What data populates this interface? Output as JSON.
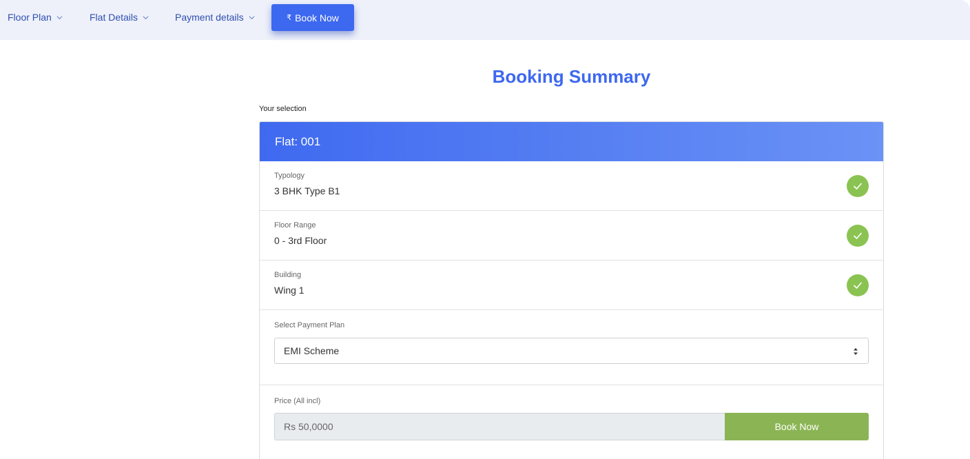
{
  "nav": {
    "items": [
      {
        "label": "Floor Plan"
      },
      {
        "label": "Flat Details"
      },
      {
        "label": "Payment details"
      }
    ],
    "book_now_label": "Book Now",
    "currency_symbol": "₹"
  },
  "page": {
    "title": "Booking Summary",
    "selection_label": "Your selection"
  },
  "card": {
    "header": "Flat: 001",
    "rows": [
      {
        "label": "Typology",
        "value": "3 BHK Type B1"
      },
      {
        "label": "Floor Range",
        "value": "0 - 3rd Floor"
      },
      {
        "label": "Building",
        "value": "Wing 1"
      }
    ],
    "payment_plan": {
      "label": "Select Payment Plan",
      "selected": "EMI Scheme"
    },
    "price": {
      "label": "Price (All incl)",
      "value": "Rs 50,0000",
      "button_label": "Book Now"
    }
  },
  "colors": {
    "accent": "#3d68f0",
    "success": "#8bc352",
    "book_button": "#8bb555",
    "nav_bg": "#eef1fa"
  }
}
